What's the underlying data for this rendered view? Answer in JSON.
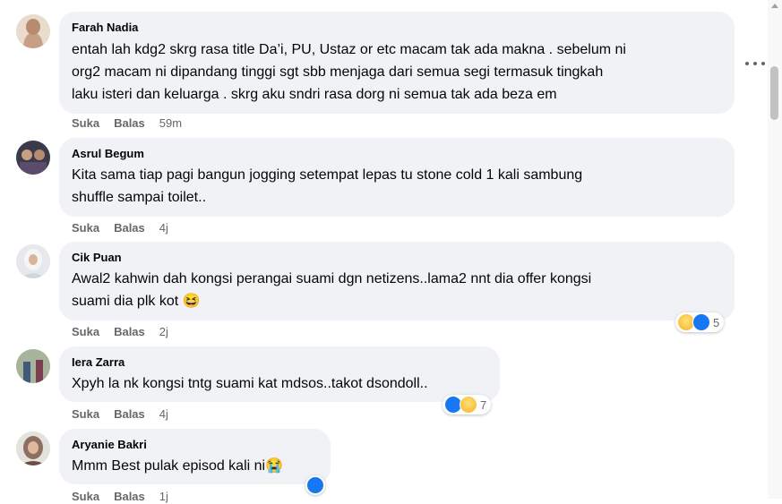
{
  "comments": [
    {
      "name": "Farah Nadia",
      "text": "entah lah kdg2 skrg rasa title Da’i, PU, Ustaz or etc macam tak ada makna . sebelum ni\norg2 macam ni dipandang tinggi sgt sbb menjaga dari semua segi termasuk tingkah\nlaku isteri dan keluarga . skrg aku sndri rasa dorg ni semua tak ada beza em",
      "like_label": "Suka",
      "reply_label": "Balas",
      "time": "59m"
    },
    {
      "name": "Asrul Begum",
      "text": "Kita sama tiap pagi bangun jogging setempat lepas tu stone cold 1 kali sambung\nshuffle sampai toilet..",
      "like_label": "Suka",
      "reply_label": "Balas",
      "time": "4j"
    },
    {
      "name": "Cik Puan",
      "text": "Awal2 kahwin dah kongsi perangai suami dgn netizens..lama2 nnt dia offer kongsi\nsuami dia plk kot 😆",
      "like_label": "Suka",
      "reply_label": "Balas",
      "time": "2j",
      "reaction_count": "5",
      "reaction_icons": [
        "haha",
        "like"
      ]
    },
    {
      "name": "Iera Zarra",
      "text": "Xpyh la nk kongsi tntg suami kat mdsos..takot dsondoll..",
      "like_label": "Suka",
      "reply_label": "Balas",
      "time": "4j",
      "reaction_count": "7",
      "reaction_icons": [
        "like",
        "haha"
      ]
    },
    {
      "name": "Aryanie Bakri",
      "text": "Mmm Best pulak episod kali ni😭",
      "like_label": "Suka",
      "reply_label": "Balas",
      "time": "1j",
      "reaction_icons": [
        "like"
      ]
    }
  ],
  "colors": {
    "bubble": "#f0f2f5",
    "meta": "#65676b",
    "like_blue": "#1877f2",
    "haha_yellow": "#f7b125"
  }
}
